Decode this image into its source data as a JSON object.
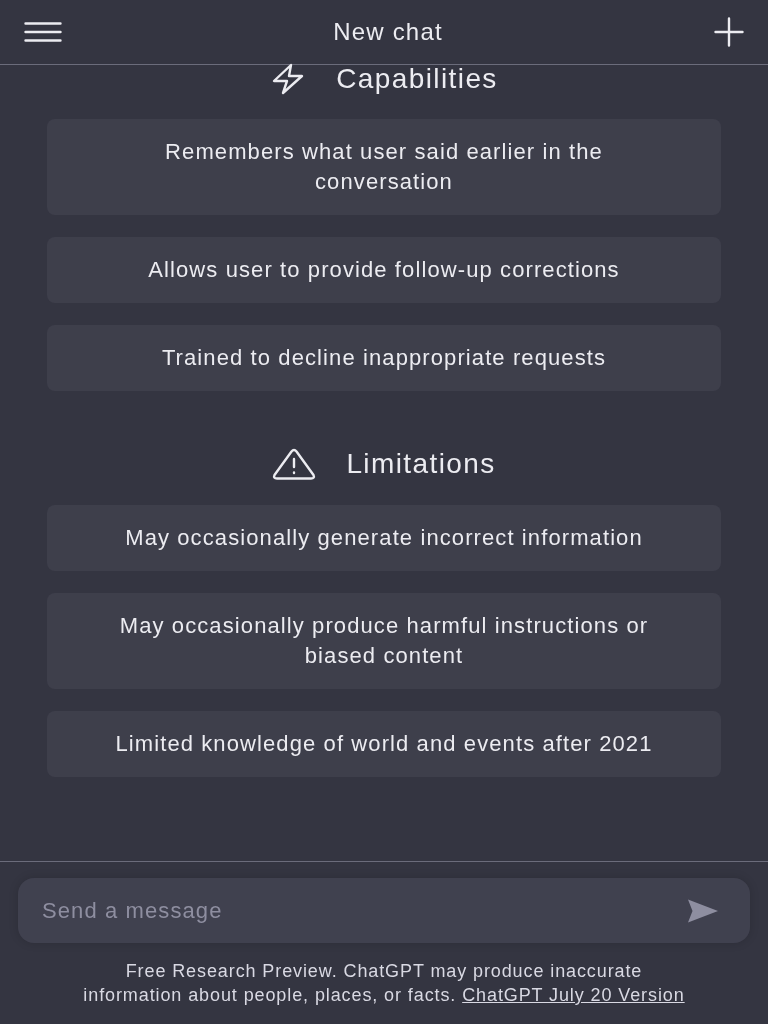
{
  "header": {
    "title": "New chat"
  },
  "sections": [
    {
      "kind": "capabilities",
      "title": "Capabilities",
      "items": [
        "Remembers what user said earlier in the conversation",
        "Allows user to provide follow-up corrections",
        "Trained to decline inappropriate requests"
      ]
    },
    {
      "kind": "limitations",
      "title": "Limitations",
      "items": [
        "May occasionally generate incorrect information",
        "May occasionally produce harmful instructions or biased content",
        "Limited knowledge of world and events after 2021"
      ]
    }
  ],
  "composer": {
    "placeholder": "Send a message"
  },
  "footer": {
    "text": "Free Research Preview. ChatGPT may produce inaccurate information about people, places, or facts.",
    "link": "ChatGPT July 20 Version"
  }
}
